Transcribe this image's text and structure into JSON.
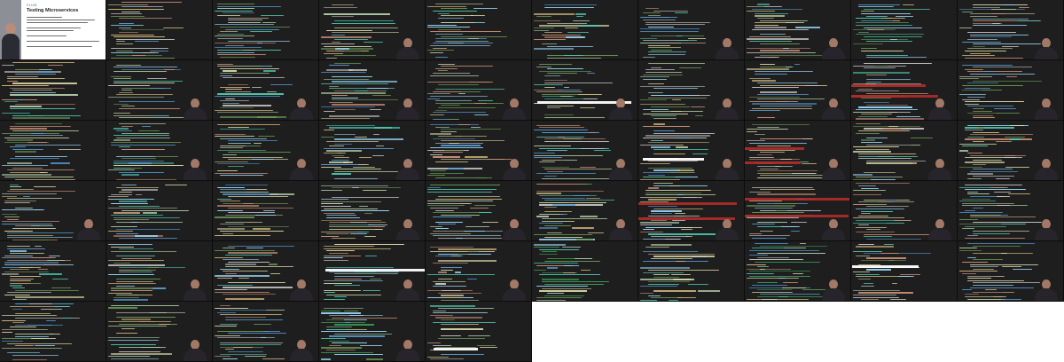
{
  "contact_sheet": {
    "columns": 10,
    "rows": 6,
    "frames_shown": 55
  },
  "slide": {
    "brand": "FLUB",
    "title": "Testing Microservices"
  },
  "colors": {
    "editor_background": "#1e1e1e",
    "code_palette": [
      "#c8c8c8",
      "#9cdcfe",
      "#dcdcaa",
      "#ce9178",
      "#569cd6",
      "#6a9955",
      "#d7ba7d",
      "#4ec9b0",
      "#b5cea8"
    ],
    "error_highlight": "#b22a2a",
    "selection_highlight": "#ffffff",
    "terminal_green": "#3aa35a",
    "slide_accent": "#2d8a4c"
  },
  "icons": {
    "presenter": "presenter-webcam-icon"
  }
}
